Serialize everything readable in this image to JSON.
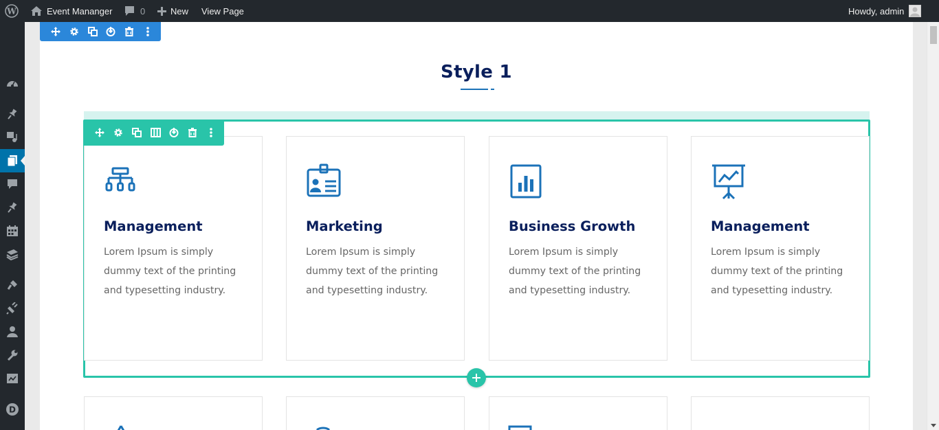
{
  "adminbar": {
    "site_name": "Event Mananger",
    "comments_count": "0",
    "new_label": "New",
    "view_page_label": "View Page",
    "greeting": "Howdy, admin"
  },
  "adminmenu": {
    "icons": [
      "dashboard-icon",
      "pin-icon",
      "media-icon",
      "pages-icon",
      "comments-icon",
      "pin-icon",
      "calendar-icon",
      "layers-icon",
      "appearance-icon",
      "plugins-icon",
      "users-icon",
      "tools-icon",
      "settings-icon",
      "divi-icon"
    ],
    "current_index": 3
  },
  "builder": {
    "section_toolbar": [
      "move-icon",
      "settings-icon",
      "duplicate-icon",
      "save-icon",
      "delete-icon",
      "more-icon"
    ],
    "row_toolbar": [
      "move-icon",
      "settings-icon",
      "duplicate-icon",
      "columns-icon",
      "save-icon",
      "delete-icon",
      "more-icon"
    ],
    "section_color": "#2b87da",
    "row_color": "#29c4a9"
  },
  "section": {
    "heading": "Style 1"
  },
  "cards": [
    {
      "icon": "org-chart-icon",
      "title": "Management",
      "desc": "Lorem Ipsum is simply dummy text of the printing and typesetting industry."
    },
    {
      "icon": "id-badge-icon",
      "title": "Marketing",
      "desc": "Lorem Ipsum is simply dummy text of the printing and typesetting industry."
    },
    {
      "icon": "bar-chart-icon",
      "title": "Business Growth",
      "desc": "Lorem Ipsum is simply dummy text of the printing and typesetting industry."
    },
    {
      "icon": "presentation-icon",
      "title": "Management",
      "desc": "Lorem Ipsum is simply dummy text of the printing and typesetting industry."
    }
  ],
  "colors": {
    "title": "#0a1f5c",
    "icon": "#1b72b8",
    "text": "#666666"
  }
}
